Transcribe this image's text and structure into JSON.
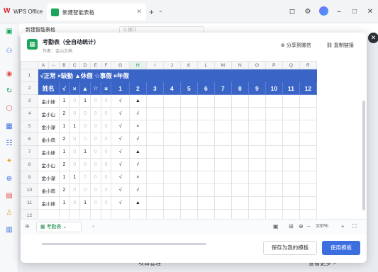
{
  "window": {
    "app_name": "WPS Office",
    "tab_title": "新建智能表格"
  },
  "background": {
    "doc_name": "新建智能表格",
    "search_placeholder": "Q 搜口",
    "bottom_left": "项目管理",
    "bottom_right": "查看更多 >"
  },
  "dialog": {
    "title": "考勤表（全自动统计）",
    "author": "作者：金山文档",
    "share_label": "分享到微信",
    "copy_label": "复制链接",
    "legend_text": "√正常 ×缺勤 ▲休假 ☆事假 ¤年假",
    "column_letters": [
      "A",
      "···",
      "B",
      "C",
      "D",
      "E",
      "F",
      "G",
      "H",
      "I",
      "J",
      "K",
      "L",
      "M",
      "N",
      "O",
      "P",
      "Q",
      "R"
    ],
    "header_row": [
      "姓名",
      "√",
      "×",
      "▲",
      "☆",
      "¤",
      "1",
      "2",
      "3",
      "4",
      "5",
      "6",
      "7",
      "8",
      "9",
      "10",
      "11",
      "12"
    ],
    "rows": [
      {
        "num": "3",
        "name": "金小妹",
        "c1": "1",
        "c2": "0",
        "c3": "1",
        "c4": "0",
        "c5": "0",
        "d1": "√",
        "d2": "▲"
      },
      {
        "num": "4",
        "name": "金小山",
        "c1": "2",
        "c2": "0",
        "c3": "0",
        "c4": "0",
        "c5": "0",
        "d1": "√",
        "d2": "√"
      },
      {
        "num": "5",
        "name": "金小濛",
        "c1": "1",
        "c2": "1",
        "c3": "0",
        "c4": "0",
        "c5": "0",
        "d1": "√",
        "d2": "×"
      },
      {
        "num": "6",
        "name": "金小萌",
        "c1": "2",
        "c2": "0",
        "c3": "0",
        "c4": "0",
        "c5": "0",
        "d1": "√",
        "d2": "√"
      },
      {
        "num": "7",
        "name": "金小妹",
        "c1": "1",
        "c2": "0",
        "c3": "1",
        "c4": "0",
        "c5": "0",
        "d1": "√",
        "d2": "▲"
      },
      {
        "num": "8",
        "name": "金小山",
        "c1": "2",
        "c2": "0",
        "c3": "0",
        "c4": "0",
        "c5": "0",
        "d1": "√",
        "d2": "√"
      },
      {
        "num": "9",
        "name": "金小濛",
        "c1": "1",
        "c2": "1",
        "c3": "0",
        "c4": "0",
        "c5": "0",
        "d1": "√",
        "d2": "×"
      },
      {
        "num": "10",
        "name": "金小萌",
        "c1": "2",
        "c2": "0",
        "c3": "0",
        "c4": "0",
        "c5": "0",
        "d1": "√",
        "d2": "√"
      },
      {
        "num": "11",
        "name": "金小妹",
        "c1": "1",
        "c2": "0",
        "c3": "1",
        "c4": "0",
        "c5": "0",
        "d1": "√",
        "d2": "▲"
      },
      {
        "num": "12",
        "name": "",
        "c1": "",
        "c2": "",
        "c3": "",
        "c4": "",
        "c5": "",
        "d1": "",
        "d2": ""
      }
    ],
    "row1_num": "1",
    "row2_num": "2",
    "sheet_tab": "考勤表",
    "zoom": "100%",
    "save_button": "保存为我的模板",
    "use_button": "使用模板"
  },
  "colors": {
    "accent_blue": "#3a64c6",
    "button_blue": "#3b6fe0",
    "sheet_green": "#1aa55b"
  }
}
